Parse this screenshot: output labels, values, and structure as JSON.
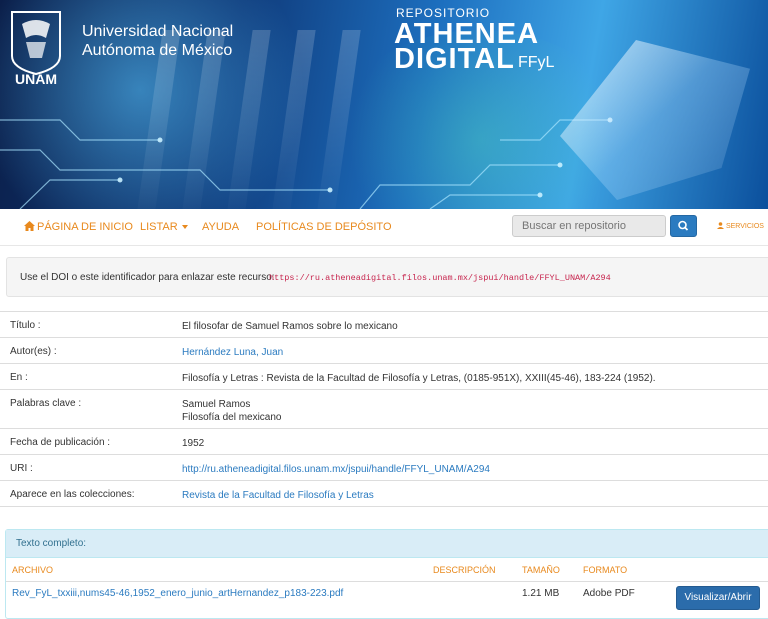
{
  "header": {
    "university": [
      "Universidad Nacional",
      "Autónoma de México"
    ],
    "logo_text": "UNAM",
    "repo_small": "REPOSITORIO",
    "repo_line1": "ATHENEA",
    "repo_line2": "DIGITAL",
    "repo_suffix": "FFyL"
  },
  "nav": {
    "home": "PÁGINA DE INICIO",
    "browse": "LISTAR",
    "help": "AYUDA",
    "policies": "POLÍTICAS DE DEPÓSITO",
    "search_placeholder": "Buscar en repositorio",
    "services": "SERVICIOS"
  },
  "doi": {
    "text": "Use el DOI o este identificador para enlazar este recurso:",
    "url": "https://ru.atheneadigital.filos.unam.mx/jspui/handle/FFYL_UNAM/A294"
  },
  "metadata": [
    {
      "label": "Título :",
      "value": [
        "El filosofar de Samuel Ramos sobre lo mexicano"
      ],
      "link": false
    },
    {
      "label": "Autor(es) :",
      "value": [
        "Hernández Luna, Juan"
      ],
      "link": true
    },
    {
      "label": "En :",
      "value": [
        "Filosofía y Letras : Revista de la Facultad de Filosofía y Letras, (0185-951X), XXIII(45-46), 183-224 (1952)."
      ],
      "link": false
    },
    {
      "label": "Palabras clave :",
      "value": [
        "Samuel Ramos",
        "Filosofía del mexicano"
      ],
      "link": false
    },
    {
      "label": "Fecha de publicación :",
      "value": [
        "1952"
      ],
      "link": false
    },
    {
      "label": "URI :",
      "value": [
        "http://ru.atheneadigital.filos.unam.mx/jspui/handle/FFYL_UNAM/A294"
      ],
      "link": true
    },
    {
      "label": "Aparece en las colecciones:",
      "value": [
        "Revista de la Facultad de Filosofía y Letras"
      ],
      "link": true
    }
  ],
  "fulltext": {
    "title": "Texto completo:",
    "columns": [
      "ARCHIVO",
      "DESCRIPCIÓN",
      "TAMAÑO",
      "FORMATO"
    ],
    "file": {
      "name": "Rev_FyL_txxiii,nums45-46,1952_enero_junio_artHernandez_p183-223.pdf",
      "description": "",
      "size": "1.21 MB",
      "format": "Adobe PDF",
      "action": "Visualizar/Abrir"
    }
  },
  "colors": {
    "accent": "#e8891d",
    "link": "#2b7bc0",
    "panel_head": "#d9edf7",
    "doi_code": "#c7254e"
  }
}
